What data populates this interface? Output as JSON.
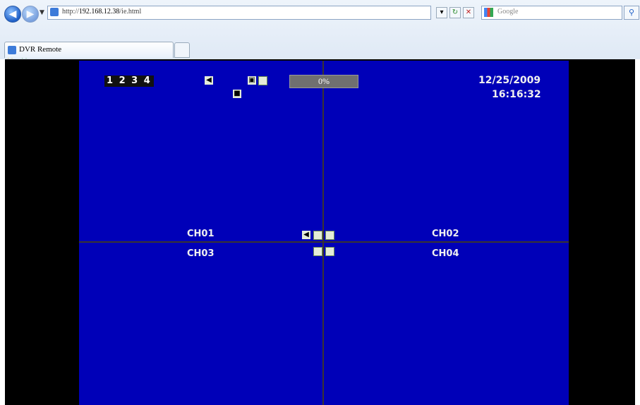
{
  "browser": {
    "url_prefix": "http://",
    "url_host": "192.168.12.38",
    "url_path": "/ie.html",
    "search_placeholder": "Google",
    "tab_title": "DVR Remote",
    "icons": [
      "back-icon",
      "forward-icon",
      "refresh-icon",
      "stop-icon",
      "search-icon",
      "favorites-star-icon",
      "add-favorites-icon",
      "home-icon",
      "feeds-icon",
      "mail-icon",
      "print-icon",
      "page-icon",
      "safety-icon",
      "tools-icon",
      "help-icon"
    ]
  },
  "dvr": {
    "channel_selector": "1 2 3 4",
    "progress_text": "0%",
    "progress_value": 0,
    "date": "12/25/2009",
    "time": "16:16:32",
    "channels": [
      "CH01",
      "CH02",
      "CH03",
      "CH04"
    ],
    "colors": {
      "background": "#0000b8",
      "divider": "#3a3430",
      "osd_text": "#f0f0f0"
    },
    "status_icons": [
      "audio-icon",
      "record-icon",
      "lock-icon",
      "motion-icon",
      "video-loss-icon"
    ]
  }
}
